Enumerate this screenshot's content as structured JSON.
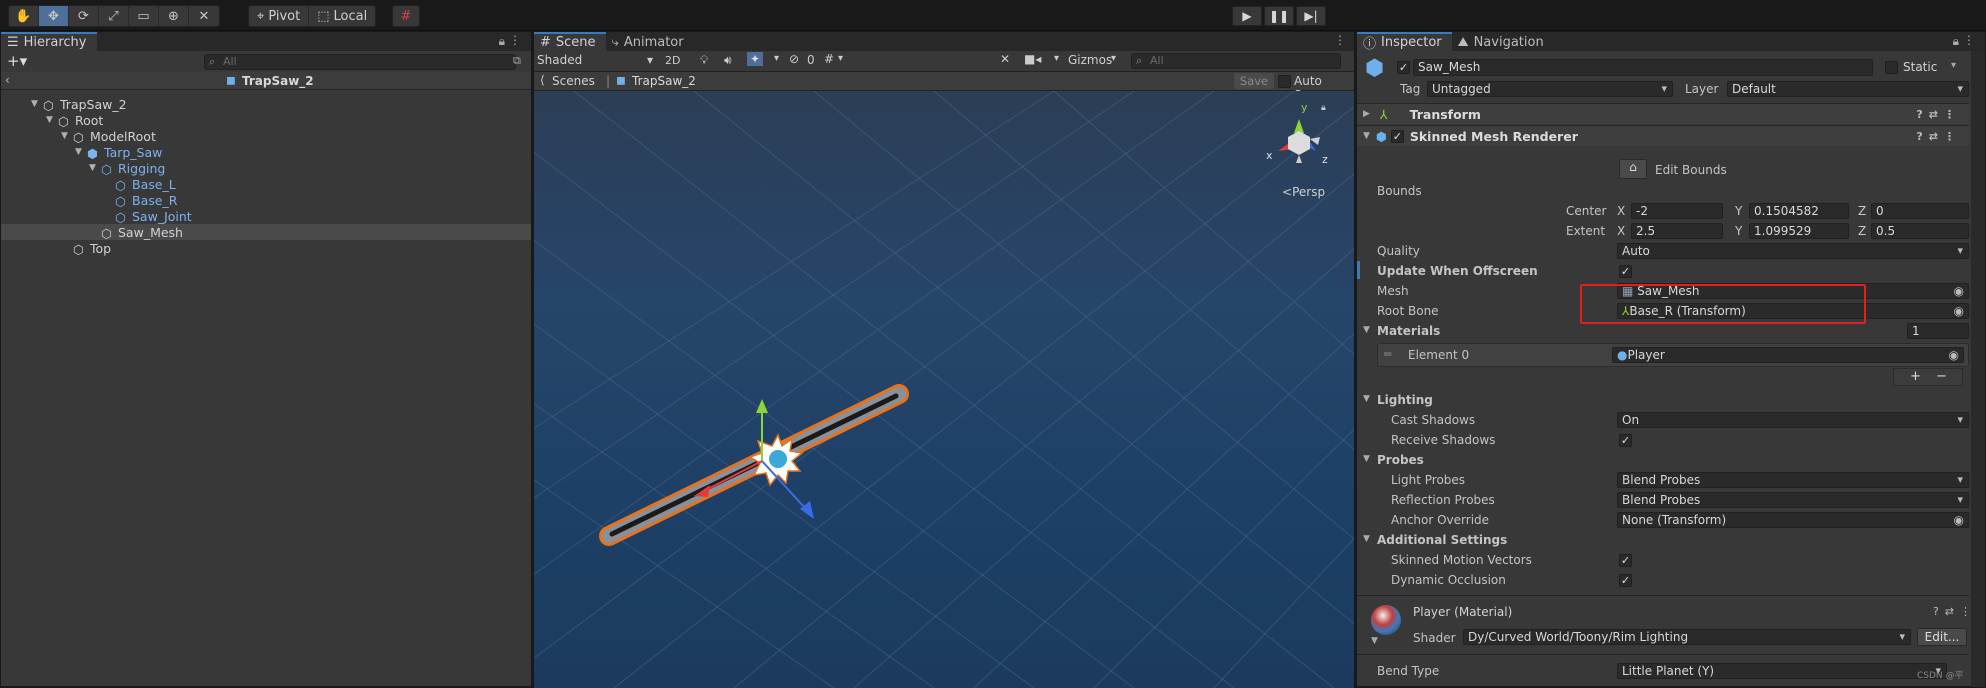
{
  "toolbar": {
    "pivot_label": "Pivot",
    "local_label": "Local"
  },
  "hierarchy": {
    "tab_label": "Hierarchy",
    "search_placeholder": "All",
    "scene_name": "TrapSaw_2",
    "items": [
      {
        "label": "TrapSaw_2"
      },
      {
        "label": "Root"
      },
      {
        "label": "ModelRoot"
      },
      {
        "label": "Tarp_Saw"
      },
      {
        "label": "Rigging"
      },
      {
        "label": "Base_L"
      },
      {
        "label": "Base_R"
      },
      {
        "label": "Saw_Joint"
      },
      {
        "label": "Saw_Mesh"
      },
      {
        "label": "Top"
      }
    ]
  },
  "scene": {
    "tab_label": "Scene",
    "animator_tab_label": "Animator",
    "shading_mode": "Shaded",
    "mode_2d": "2D",
    "hidden_count": "0",
    "gizmos_label": "Gizmos",
    "search_placeholder": "All",
    "breadcrumb_root": "Scenes",
    "breadcrumb_item": "TrapSaw_2",
    "save_label": "Save",
    "autosave_label": "Auto Save",
    "persp_label": "Persp",
    "axis_y": "y",
    "axis_x": "x",
    "axis_z": "z"
  },
  "inspector": {
    "tab_label": "Inspector",
    "nav_tab_label": "Navigation",
    "object_name": "Saw_Mesh",
    "static_label": "Static",
    "tag_label": "Tag",
    "tag_value": "Untagged",
    "layer_label": "Layer",
    "layer_value": "Default",
    "transform_label": "Transform",
    "smr_label": "Skinned Mesh Renderer",
    "edit_bounds_label": "Edit Bounds",
    "bounds_label": "Bounds",
    "center_label": "Center",
    "extent_label": "Extent",
    "center": {
      "x": "-2",
      "y": "0.1504582",
      "z": "0"
    },
    "extent": {
      "x": "2.5",
      "y": "1.099529",
      "z": "0.5"
    },
    "x_label": "X",
    "y_label": "Y",
    "z_label": "Z",
    "quality_label": "Quality",
    "quality_value": "Auto",
    "update_offscreen_label": "Update When Offscreen",
    "mesh_label": "Mesh",
    "mesh_value": "Saw_Mesh",
    "root_bone_label": "Root Bone",
    "root_bone_value": "Base_R (Transform)",
    "materials_label": "Materials",
    "materials_count": "1",
    "element0_label": "Element 0",
    "element0_value": "Player",
    "lighting_label": "Lighting",
    "cast_shadows_label": "Cast Shadows",
    "cast_shadows_value": "On",
    "receive_shadows_label": "Receive Shadows",
    "probes_label": "Probes",
    "light_probes_label": "Light Probes",
    "light_probes_value": "Blend Probes",
    "reflection_probes_label": "Reflection Probes",
    "reflection_probes_value": "Blend Probes",
    "anchor_override_label": "Anchor Override",
    "anchor_override_value": "None (Transform)",
    "additional_label": "Additional Settings",
    "skinned_mv_label": "Skinned Motion Vectors",
    "dynamic_occ_label": "Dynamic Occlusion",
    "material_name": "Player (Material)",
    "shader_label": "Shader",
    "shader_value": "Dy/Curved World/Toony/Rim Lighting",
    "edit_label": "Edit...",
    "bend_type_label": "Bend Type",
    "bend_type_value": "Little Planet (Y)",
    "watermark": "CSDN @平"
  },
  "colors": {
    "accent": "#3a79bb",
    "highlight_box": "#e02020",
    "selection_outline": "#e8721c"
  }
}
